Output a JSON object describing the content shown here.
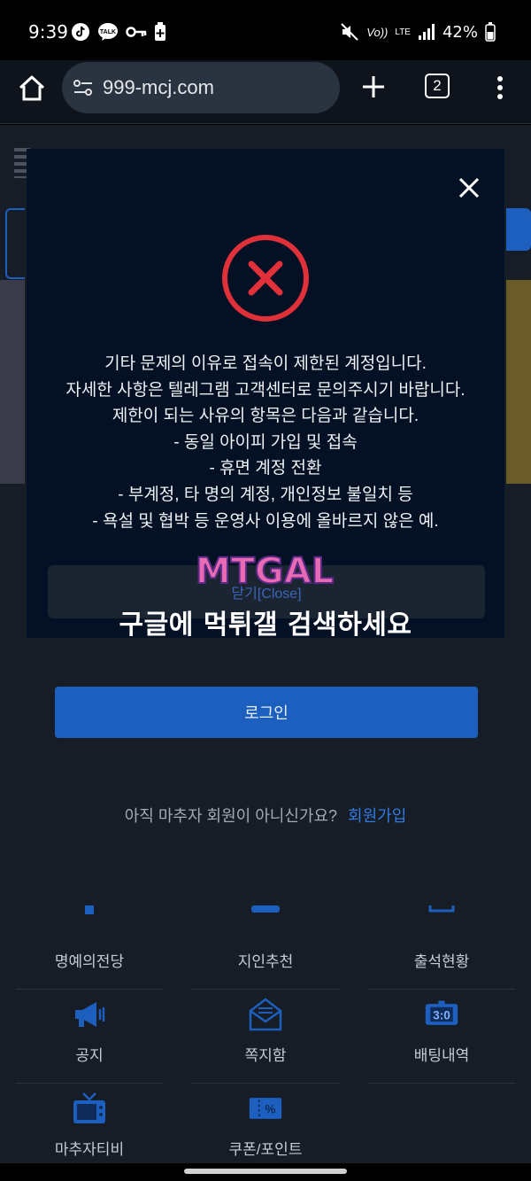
{
  "status_bar": {
    "time": "9:39",
    "left_icons": [
      "tiktok-icon",
      "talk-icon",
      "key-icon",
      "battery-plus-icon"
    ],
    "right_icons": [
      "mute-icon",
      "volte-icon",
      "lte-icon",
      "signal-icon",
      "battery-icon"
    ],
    "volte": "Vo))",
    "lte": "LTE",
    "battery_percent": "42%"
  },
  "browser": {
    "url": "999-mcj.com",
    "tab_count": "2"
  },
  "modal": {
    "message_lines": [
      "기타 문제의 이유로 접속이 제한된 계정입니다.",
      "자세한 사항은 텔레그램 고객센터로 문의주시기 바랍니다.",
      "제한이 되는 사유의 항목은 다음과 같습니다.",
      "- 동일 아이피 가입 및 접속",
      "- 휴면 계정 전환",
      "- 부계정, 타 명의 계정, 개인정보 불일치 등",
      "- 욕설 및 협박 등 운영사 이용에 올바르지 않은 예."
    ],
    "close_label": "닫기[Close]"
  },
  "watermark": {
    "logo": "MTGAL",
    "caption": "구글에 먹튀갤 검색하세요"
  },
  "page": {
    "login_label": "로그인",
    "signup_prompt": "아직 마추자 회원이 아니신가요?",
    "signup_link": "회원가입",
    "menu": [
      {
        "label": "명예의전당",
        "icon": "trophy-icon"
      },
      {
        "label": "지인추천",
        "icon": "recommend-icon"
      },
      {
        "label": "출석현황",
        "icon": "attendance-icon"
      },
      {
        "label": "공지",
        "icon": "megaphone-icon"
      },
      {
        "label": "쪽지함",
        "icon": "mail-icon"
      },
      {
        "label": "배팅내역",
        "icon": "scoreboard-icon"
      },
      {
        "label": "마추자티비",
        "icon": "tv-icon"
      },
      {
        "label": "쿠폰/포인트",
        "icon": "coupon-icon"
      }
    ],
    "scoreboard_text": "3:0",
    "coupon_text": "%"
  },
  "colors": {
    "accent_blue": "#1d5fbf",
    "link_blue": "#2f7be0",
    "error_red": "#e0303a",
    "modal_bg": "#041124",
    "page_bg": "#171d26"
  }
}
